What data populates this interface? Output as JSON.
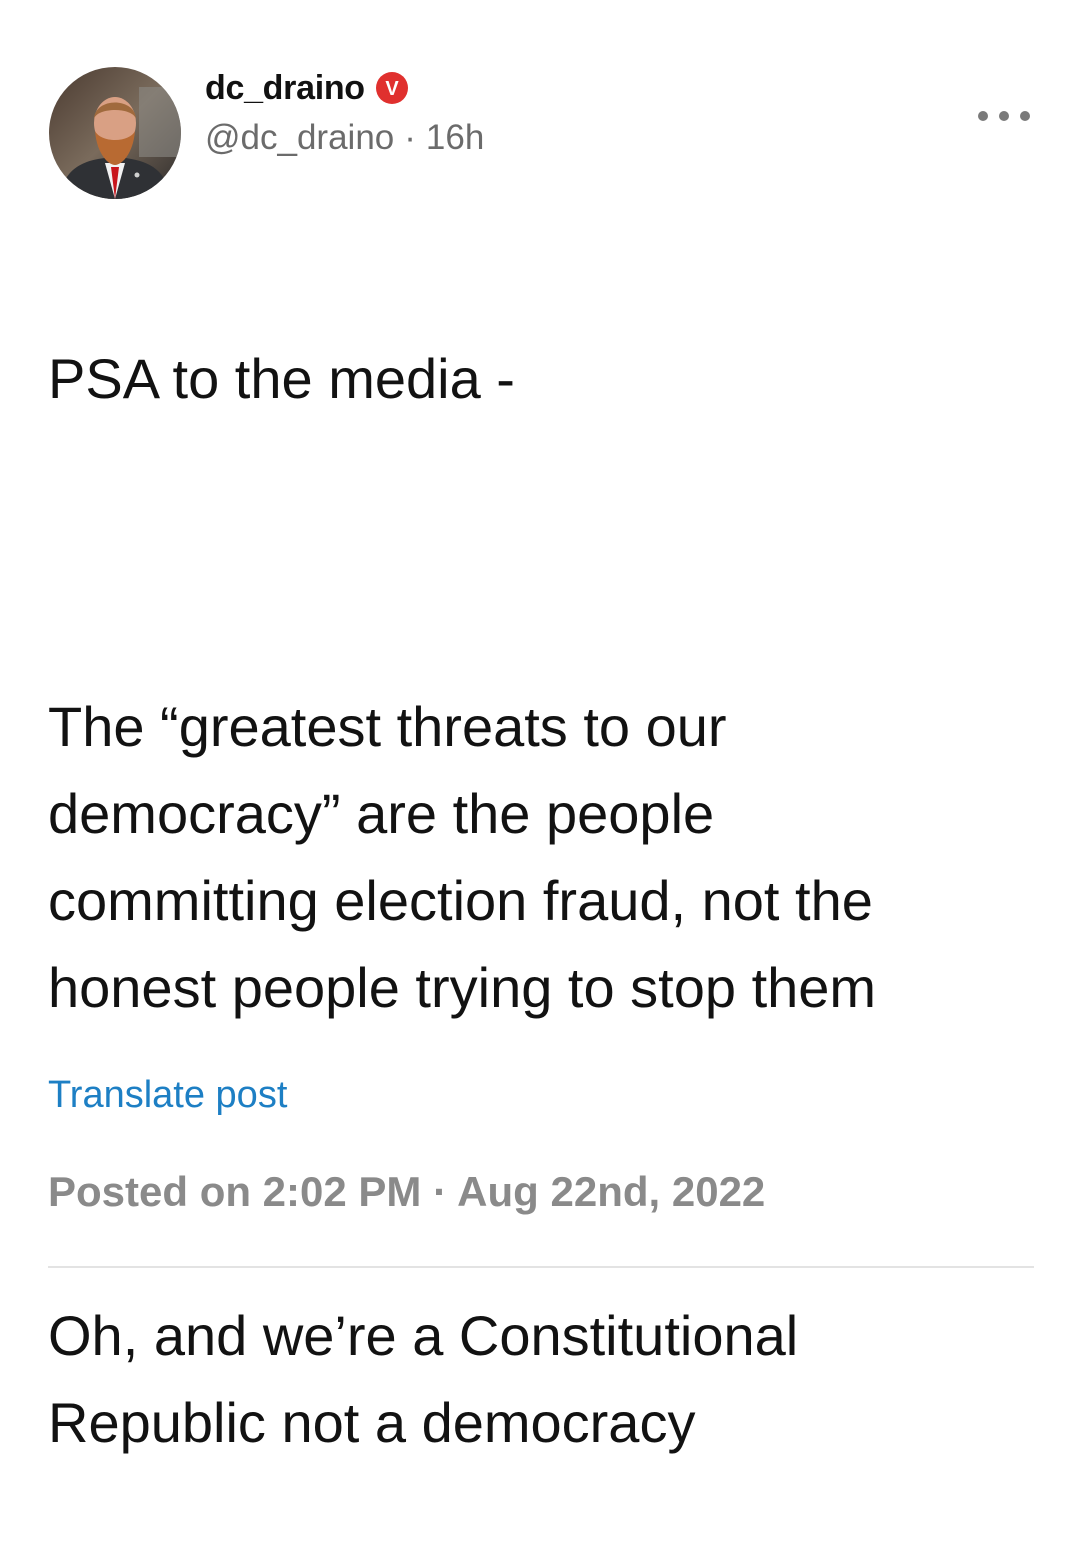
{
  "author": {
    "display_name": "dc_draino",
    "handle": "@dc_draino",
    "separator": "·",
    "time_ago": "16h",
    "badge_letter": "V",
    "badge_color": "#e0302e"
  },
  "post": {
    "paragraphs": [
      "PSA to the media -",
      "The “greatest threats to our democracy” are the people committing election fraud, not the honest people trying to stop them",
      "Oh, and we’re a Constitutional Republic not a democracy"
    ],
    "translate_label": "Translate post",
    "posted_label": "Posted on 2:02 PM · Aug 22nd, 2022"
  },
  "icons": {
    "more": "more-options-icon",
    "badge": "verified-badge-icon"
  },
  "colors": {
    "link": "#1d7fc4",
    "muted": "#6b6b6b",
    "text": "#121212"
  }
}
